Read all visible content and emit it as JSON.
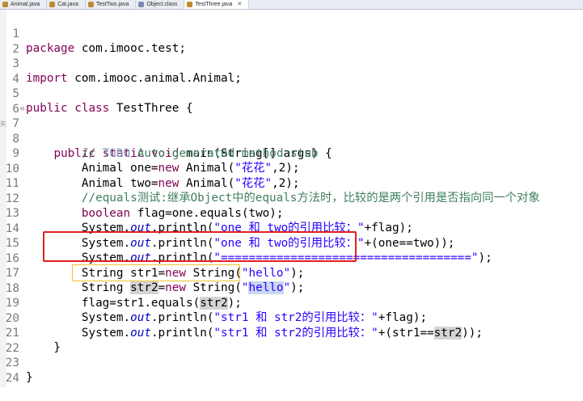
{
  "tabs": [
    {
      "label": "Animal.java",
      "icon": "java-file-icon"
    },
    {
      "label": "Cat.java",
      "icon": "java-file-icon"
    },
    {
      "label": "TestTwo.java",
      "icon": "java-file-icon"
    },
    {
      "label": "Object.class",
      "icon": "class-file-icon"
    },
    {
      "label": "TestThree.java",
      "icon": "java-file-icon",
      "active": true
    }
  ],
  "side_mark": "失",
  "lines": {
    "n1": "1",
    "n2": "2",
    "n3": "3",
    "n4": "4",
    "n5": "5",
    "n6": "6",
    "n7": "7",
    "n8": "8",
    "n9": "9",
    "n10": "10",
    "n11": "11",
    "n12": "12",
    "n13": "13",
    "n14": "14",
    "n15": "15",
    "n16": "16",
    "n17": "17",
    "n18": "18",
    "n19": "19",
    "n20": "20",
    "n21": "21",
    "n22": "22",
    "n23": "23",
    "n24": "24"
  },
  "code": {
    "l1_kw": "package",
    "l1_rest": " com.imooc.test;",
    "l3_kw": "import",
    "l3_rest": " com.imooc.animal.Animal;",
    "l5_kw": "public class",
    "l5_rest": " TestThree {",
    "l7_indent": "    ",
    "l7_kw": "public static void",
    "l7_rest": " main(String[] args) {",
    "l8_indent": "        ",
    "l8_cmt1": "// ",
    "l8_todo": "TODO",
    "l8_cmt2": " Auto-generated method stub",
    "l9_pre": "        Animal one=",
    "l9_kw": "new",
    "l9_mid": " Animal(",
    "l9_str": "\"花花\"",
    "l9_post": ",2);",
    "l10_pre": "        Animal two=",
    "l10_kw": "new",
    "l10_mid": " Animal(",
    "l10_str": "\"花花\"",
    "l10_post": ",2);",
    "l11_indent": "        ",
    "l11_cmt": "//equals测试:继承Object中的equals方法时，比较的是两个引用是否指向同一个对象",
    "l12_indent": "        ",
    "l12_kw": "boolean",
    "l12_rest": " flag=one.equals(two);",
    "l13_pre": "        System.",
    "l13_out": "out",
    "l13_mid": ".println(",
    "l13_str": "\"one 和 two的引用比较：\"",
    "l13_post": "+flag);",
    "l14_pre": "        System.",
    "l14_out": "out",
    "l14_mid": ".println(",
    "l14_str": "\"one 和 two的引用比较：\"",
    "l14_post": "+(one==two));",
    "l15_pre": "        System.",
    "l15_out": "out",
    "l15_mid": ".println(",
    "l15_str": "\"====================================\"",
    "l15_post": ");",
    "l16_pre": "        String str1=",
    "l16_kw": "new",
    "l16_mid": " String(",
    "l16_str": "\"hello\"",
    "l16_post": ");",
    "l17_pre": "        String ",
    "l17_var": "str2",
    "l17_eq": "=",
    "l17_kw": "new",
    "l17_mid": " String(",
    "l17_q1": "\"",
    "l17_sel": "hello",
    "l17_q2": "\"",
    "l17_post": ");",
    "l18_pre": "        flag=str1.equals(",
    "l18_var": "str2",
    "l18_post": ");",
    "l19_pre": "        System.",
    "l19_out": "out",
    "l19_mid": ".println(",
    "l19_str": "\"str1 和 str2的引用比较：\"",
    "l19_post": "+flag);",
    "l20_pre": "        System.",
    "l20_out": "out",
    "l20_mid": ".println(",
    "l20_str": "\"str1 和 str2的引用比较：\"",
    "l20_post1": "+(str1==",
    "l20_var": "str2",
    "l20_post2": "));",
    "l21": "    }",
    "l23": "}"
  },
  "colors": {
    "keyword": "#7f0055",
    "string": "#2a00ff",
    "comment": "#3f7f5f",
    "static_field": "#0000c0",
    "red_highlight_box": "#e02020",
    "yellow_highlight_box": "#f2c233"
  }
}
